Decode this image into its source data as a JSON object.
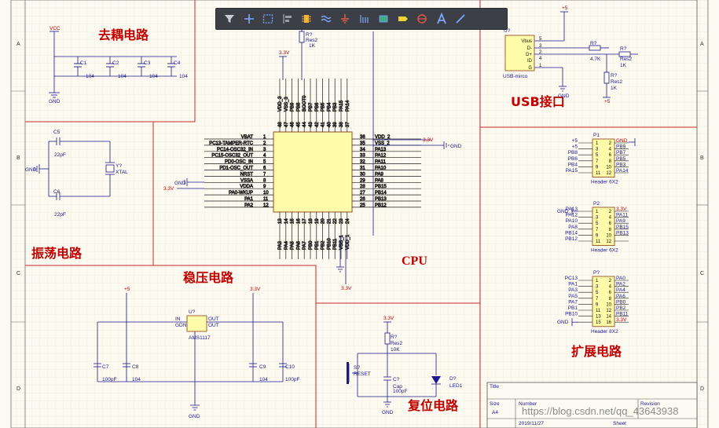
{
  "toolbar": {
    "tools": [
      "filter-icon",
      "cross-probe-icon",
      "select-rect-icon",
      "align-icon",
      "part-icon",
      "wire-icon",
      "power-port-icon",
      "bus-icon",
      "sheet-symbol-icon",
      "net-label-icon",
      "no-erc-icon",
      "text-icon",
      "line-icon"
    ]
  },
  "sections": {
    "decoupling": "去耦电路",
    "oscillator": "振荡电路",
    "regulator": "稳压电路",
    "cpu": "CPU",
    "usb": "USB接口",
    "reset": "复位电路",
    "expansion": "扩展电路"
  },
  "zones": {
    "left": [
      "A",
      "B",
      "C",
      "D"
    ],
    "right": [
      "A",
      "B",
      "C",
      "D"
    ]
  },
  "decoupling": {
    "vcc": "VCC",
    "gnd": "GND",
    "caps": [
      {
        "ref": "C1",
        "val": "104"
      },
      {
        "ref": "C2",
        "val": "104"
      },
      {
        "ref": "C3",
        "val": "104"
      },
      {
        "ref": "C4",
        "val": "104"
      }
    ]
  },
  "oscillator": {
    "c5": "C5",
    "c5v": "22pF",
    "c6": "C6",
    "c6v": "22pF",
    "y": "Y?",
    "yv": "XTAL",
    "gnd": "GND"
  },
  "cpu": {
    "top_res": "R?",
    "top_res_val": "Res2",
    "top_res_k": "1K",
    "v33_top": "3.3V",
    "left_pins": [
      {
        "n": "1",
        "name": "VBAT"
      },
      {
        "n": "2",
        "name": "PC13-TAMPER-RTC"
      },
      {
        "n": "3",
        "name": "PC14-OSC32_IN"
      },
      {
        "n": "4",
        "name": "PC15-OSC32_OUT"
      },
      {
        "n": "5",
        "name": "PD0-OSC_IN"
      },
      {
        "n": "6",
        "name": "PD1-OSC_OUT"
      },
      {
        "n": "7",
        "name": "NRST"
      },
      {
        "n": "8",
        "name": "VSSA"
      },
      {
        "n": "9",
        "name": "VDDA"
      },
      {
        "n": "10",
        "name": "PA0-WKUP"
      },
      {
        "n": "11",
        "name": "PA1"
      },
      {
        "n": "12",
        "name": "PA2"
      }
    ],
    "right_pins": [
      {
        "n": "36",
        "name": "VDD_2"
      },
      {
        "n": "35",
        "name": "VSS_2"
      },
      {
        "n": "34",
        "name": "PA13"
      },
      {
        "n": "33",
        "name": "PA12"
      },
      {
        "n": "32",
        "name": "PA11"
      },
      {
        "n": "31",
        "name": "PA10"
      },
      {
        "n": "30",
        "name": "PA9"
      },
      {
        "n": "29",
        "name": "PA8"
      },
      {
        "n": "28",
        "name": "PB15"
      },
      {
        "n": "27",
        "name": "PB14"
      },
      {
        "n": "26",
        "name": "PB13"
      },
      {
        "n": "25",
        "name": "PB12"
      }
    ],
    "top_pins": [
      "VDD_3",
      "VSS_3",
      "PB9",
      "PB8",
      "BOOT0",
      "PB7",
      "PB6",
      "PB5",
      "PB4",
      "PB3",
      "PA15",
      "PA14"
    ],
    "top_nums": [
      "48",
      "47",
      "46",
      "45",
      "44",
      "43",
      "42",
      "41",
      "40",
      "39",
      "38",
      "37"
    ],
    "bottom_pins": [
      "PA3",
      "PA4",
      "PA5",
      "PA6",
      "PA7",
      "PB0",
      "PB1",
      "PB2",
      "PB10",
      "PB11",
      "VSS_1",
      "VDD_1"
    ],
    "bottom_nums": [
      "13",
      "14",
      "15",
      "16",
      "17",
      "18",
      "19",
      "20",
      "21",
      "22",
      "23",
      "24"
    ],
    "v33_right": "3.3V",
    "gnd_right": "GND",
    "v33_left": "3.3V",
    "gnd_left": "GND",
    "v33_bottom": "3.3V"
  },
  "regulator": {
    "ref": "U?",
    "part": "AMS1117",
    "in": "IN",
    "gnd_pin": "GDN",
    "out1": "OUT",
    "out2": "OUT",
    "plus5": "+5",
    "v33": "3.3V",
    "gnd": "GND",
    "caps": [
      {
        "ref": "C7",
        "val": "100pF"
      },
      {
        "ref": "C8",
        "val": "104"
      },
      {
        "ref": "C9",
        "val": "104"
      },
      {
        "ref": "C10",
        "val": "100pF"
      }
    ]
  },
  "usb": {
    "ref": "U?",
    "part": "USB-mirco",
    "pins": [
      "Vbus",
      "D-",
      "D+",
      "ID",
      "G"
    ],
    "nums": [
      "5",
      "3",
      "2",
      "4",
      "1"
    ],
    "plus5": "+5",
    "gnd": "GND",
    "r1": "R?",
    "r1v": "4.7K",
    "r2": "R?",
    "r2v": "Res2",
    "r2k": "1K",
    "r3": "R?",
    "r3v": "Res2",
    "r3k": "1K",
    "v5b": "+5"
  },
  "header1": {
    "ref": "P1",
    "part": "Header 6X2",
    "left": [
      "+5",
      "+5",
      "PB8",
      "PB6",
      "PB4",
      "PA15"
    ],
    "right": [
      "GND",
      "PB9",
      "PB7",
      "PB5",
      "PB3",
      "PA14"
    ],
    "gnd": "GND"
  },
  "header2": {
    "ref": "P2",
    "part": "Header 6X2",
    "left": [
      "PA13",
      "PA12",
      "PA10",
      "PA8",
      "PB14",
      "PB12"
    ],
    "right": [
      "3.3V",
      "PA11",
      "PA9",
      "PB15",
      "PB13",
      ""
    ],
    "gnd": "GND",
    "v33": "3.3V"
  },
  "header3": {
    "ref": "P?",
    "part": "Header 8X2",
    "left": [
      "PC13",
      "PA1",
      "PA3",
      "PA5",
      "PA7",
      "PB1",
      "PB10",
      ""
    ],
    "right": [
      "PA0",
      "PA2",
      "PA4",
      "PA6",
      "PB0",
      "PB2",
      "PB11",
      "3.3V"
    ],
    "gnd": "GND",
    "v33": "3.3V"
  },
  "reset": {
    "v33": "3.3V",
    "r": "R?",
    "rv": "Res2",
    "rk": "10K",
    "s": "S?",
    "sv": "RESET",
    "c": "C?",
    "cv": "Cap",
    "cv2": "100pF",
    "d": "D?",
    "dv": "LED1",
    "gnd": "GND"
  },
  "titleblock": {
    "title": "Title",
    "size": "Size",
    "size_val": "A4",
    "number": "Number",
    "revision": "Revision",
    "date": "2019/11/27",
    "sheet": "Sheet"
  },
  "watermark": "https://blog.csdn.net/qq_43643938"
}
